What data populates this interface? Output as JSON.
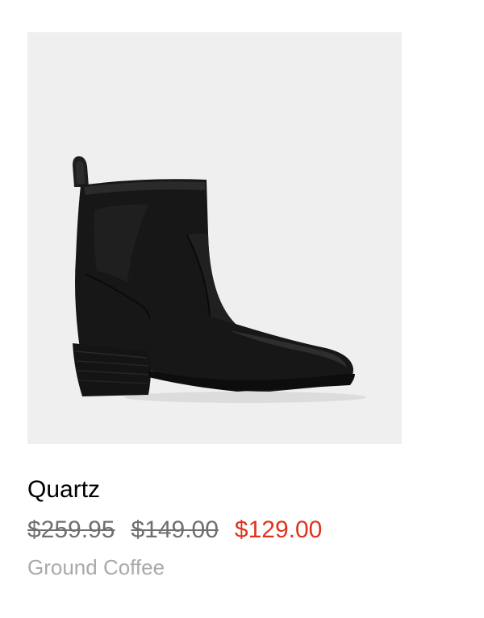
{
  "product": {
    "name": "Quartz",
    "price_original": "$259.95",
    "price_previous": "$149.00",
    "price_sale": "$129.00",
    "color": "Ground Coffee",
    "image_icon": "boot-image"
  },
  "colors": {
    "image_background": "#efefef",
    "sale": "#e0331d",
    "strikethrough": "#6f6f6f",
    "color_label": "#a9a9a9"
  }
}
